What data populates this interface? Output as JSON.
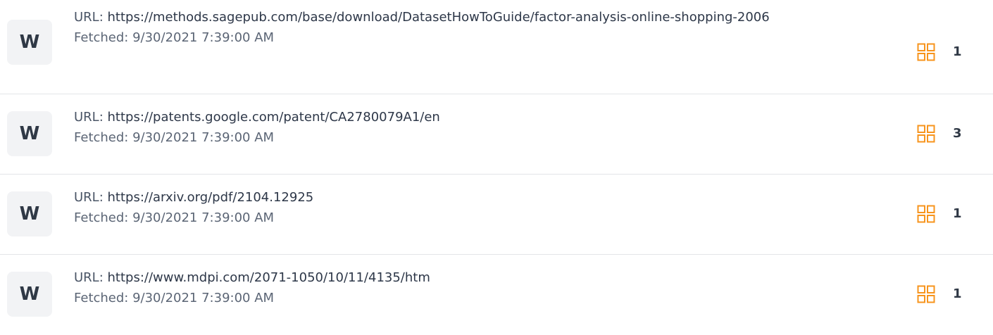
{
  "colors": {
    "accent": "#f7941d",
    "text": "#4a5566",
    "divider": "#e3e5e8",
    "badge_bg": "#f2f3f5"
  },
  "sources": [
    {
      "badge": "W",
      "url_prefix": "URL: ",
      "url": "https://methods.sagepub.com/base/download/DatasetHowToGuide/factor-analysis-online-shopping-2006",
      "fetched": "Fetched: 9/30/2021 7:39:00 AM",
      "icon": "grid-icon",
      "count": "1"
    },
    {
      "badge": "W",
      "url_prefix": "URL: ",
      "url": "https://patents.google.com/patent/CA2780079A1/en",
      "fetched": "Fetched: 9/30/2021 7:39:00 AM",
      "icon": "grid-icon",
      "count": "3"
    },
    {
      "badge": "W",
      "url_prefix": "URL: ",
      "url": "https://arxiv.org/pdf/2104.12925",
      "fetched": "Fetched: 9/30/2021 7:39:00 AM",
      "icon": "grid-icon",
      "count": "1"
    },
    {
      "badge": "W",
      "url_prefix": "URL: ",
      "url": "https://www.mdpi.com/2071-1050/10/11/4135/htm",
      "fetched": "Fetched: 9/30/2021 7:39:00 AM",
      "icon": "grid-icon",
      "count": "1"
    }
  ]
}
